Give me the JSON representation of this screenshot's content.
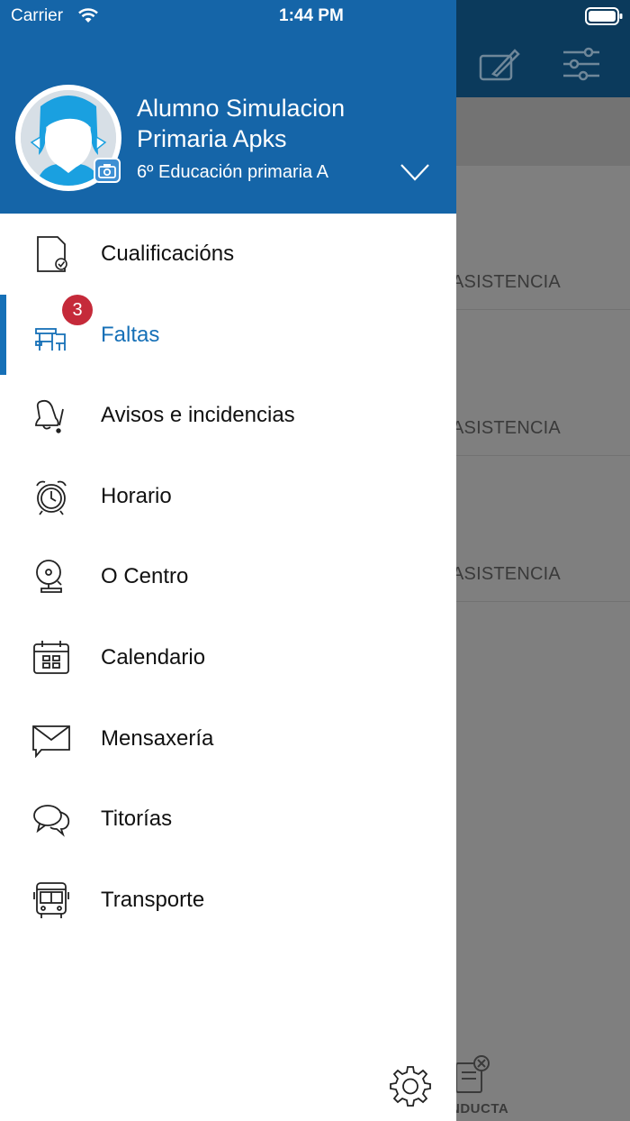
{
  "status_bar": {
    "carrier": "Carrier",
    "time": "1:44 PM"
  },
  "profile": {
    "name": "Alumno Simulacion Primaria Apks",
    "class": "6º Educación primaria A"
  },
  "menu": {
    "items": [
      {
        "label": "Cualificacións",
        "icon": "document-check-icon"
      },
      {
        "label": "Faltas",
        "icon": "school-desk-icon",
        "badge": "3",
        "active": true
      },
      {
        "label": "Avisos e incidencias",
        "icon": "bell-alert-icon"
      },
      {
        "label": "Horario",
        "icon": "alarm-clock-icon"
      },
      {
        "label": "O Centro",
        "icon": "school-bell-icon"
      },
      {
        "label": "Calendario",
        "icon": "calendar-icon"
      },
      {
        "label": "Mensaxería",
        "icon": "envelope-icon"
      },
      {
        "label": "Titorías",
        "icon": "chat-bubbles-icon"
      },
      {
        "label": "Transporte",
        "icon": "bus-icon"
      }
    ]
  },
  "background": {
    "rows": [
      "ASISTENCIA",
      "ASISTENCIA",
      "ASISTENCIA"
    ],
    "bottom_tab": "NDUCTA"
  },
  "colors": {
    "header_blue": "#1565a8",
    "accent": "#1670b7",
    "badge_red": "#c52a3a"
  }
}
